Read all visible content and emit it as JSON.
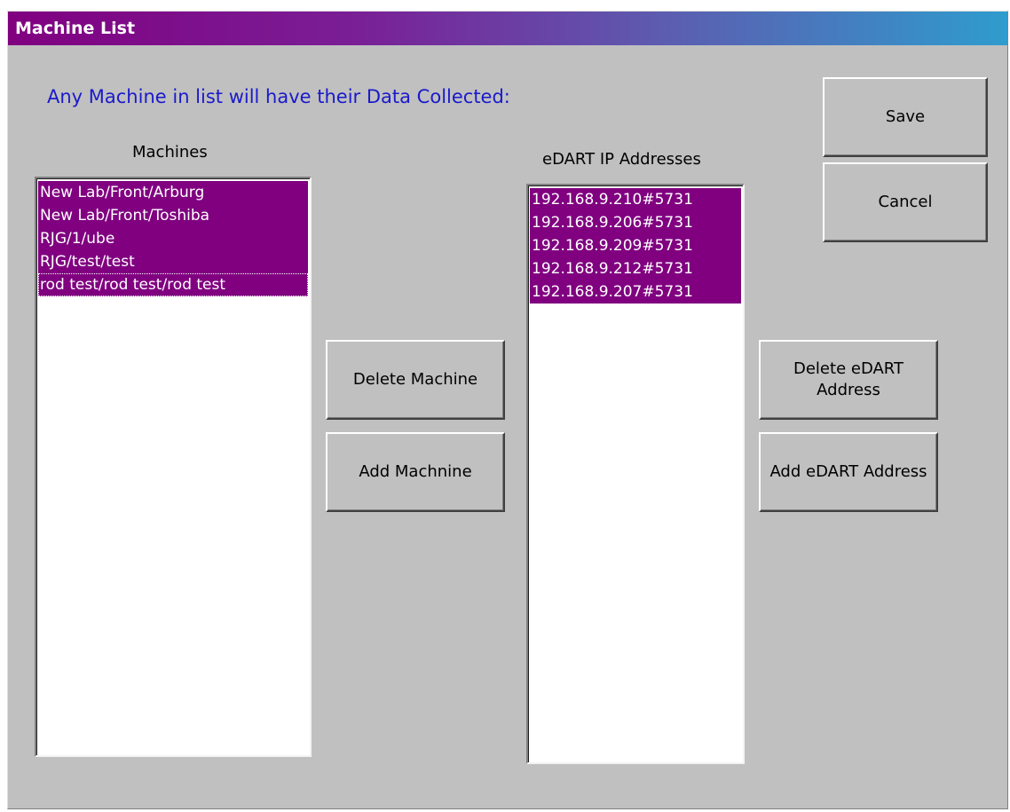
{
  "window": {
    "title": "Machine List"
  },
  "instruction": "Any Machine in list will have their Data Collected:",
  "machines": {
    "caption": "Machines",
    "items": [
      "New Lab/Front/Arburg",
      "New Lab/Front/Toshiba",
      "RJG/1/ube",
      "RJG/test/test",
      "rod test/rod test/rod test"
    ]
  },
  "edart": {
    "caption": "eDART IP Addresses",
    "items": [
      "192.168.9.210#5731",
      "192.168.9.206#5731",
      "192.168.9.209#5731",
      "192.168.9.212#5731",
      "192.168.9.207#5731"
    ]
  },
  "buttons": {
    "save": "Save",
    "cancel": "Cancel",
    "delete_machine": "Delete Machine",
    "add_machine": "Add Machnine",
    "delete_edart": "Delete eDART Address",
    "add_edart": "Add eDART Address"
  },
  "colors": {
    "selection": "#800080",
    "instruction_text": "#1a1acc",
    "dialog_face": "#c0c0c0"
  }
}
